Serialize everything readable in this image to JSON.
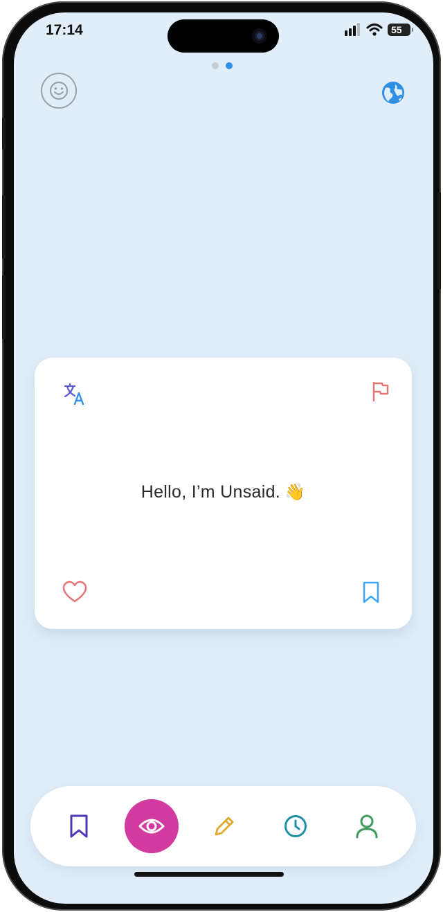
{
  "status_bar": {
    "time": "17:14",
    "battery_level": "55"
  },
  "pager": {
    "page_count": 2,
    "active_page": 2,
    "inactive_color": "#c7cdd3",
    "active_color": "#2f8ee6"
  },
  "header": {
    "left_icon": "smiley-face-icon",
    "right_icon": "globe-icon",
    "left_color": "#9aa0a6",
    "right_color": "#2f8ee6"
  },
  "card": {
    "message": "Hello, I’m Unsaid.",
    "emoji": "👋",
    "top_left_icon": "translate-icon",
    "top_right_icon": "flag-icon",
    "bottom_left_icon": "heart-icon",
    "bottom_right_icon": "bookmark-icon",
    "translate_color": "#5b5bd6",
    "flag_color": "#e57373",
    "heart_color": "#e57373",
    "bookmark_color": "#42a5f5"
  },
  "nav": {
    "items": [
      {
        "icon": "bookmark-icon",
        "color": "#4e35b5"
      },
      {
        "icon": "eye-icon",
        "color": "#ffffff",
        "bg": "#d13a9f",
        "active": true
      },
      {
        "icon": "pencil-icon",
        "color": "#e0a82e"
      },
      {
        "icon": "clock-icon",
        "color": "#1f8fa3"
      },
      {
        "icon": "user-icon",
        "color": "#3f9b5a"
      }
    ]
  }
}
